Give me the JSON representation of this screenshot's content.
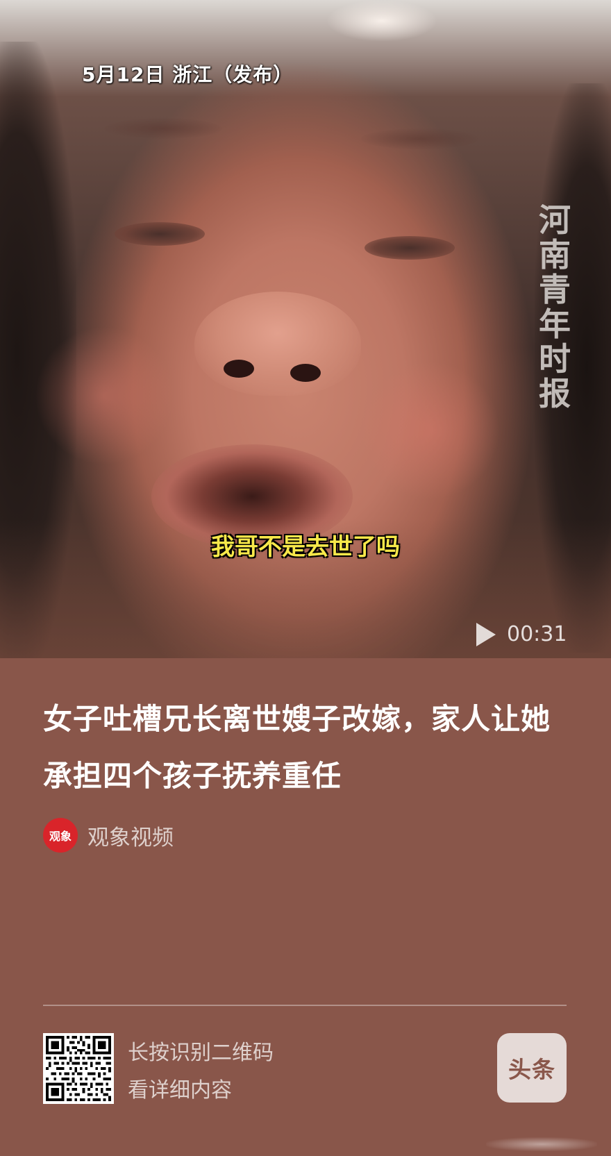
{
  "video": {
    "date_location": "5月12日 浙江（发布）",
    "watermark": "河南青年时报",
    "subtitle": "我哥不是去世了吗",
    "duration": "00:31"
  },
  "article": {
    "headline": "女子吐槽兄长离世嫂子改嫁，家人让她承担四个孩子抚养重任",
    "source_logo_text": "观象",
    "source_name": "观象视频"
  },
  "footer": {
    "qr_hint_line1": "长按识别二维码",
    "qr_hint_line2": "看详细内容",
    "brand_logo_text": "头条"
  },
  "colors": {
    "background": "#89564a",
    "subtitle": "#f7e84a",
    "source_logo": "#d9242a"
  }
}
